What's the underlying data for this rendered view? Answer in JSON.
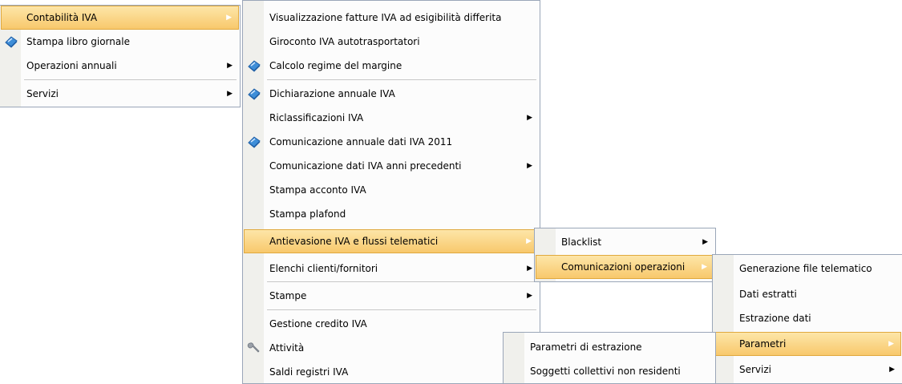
{
  "menu1": {
    "items": [
      {
        "label": "Contabilità IVA",
        "icon": "",
        "submenu": true,
        "highlighted": true
      },
      {
        "label": "Stampa libro giornale",
        "icon": "book-icon",
        "submenu": false
      },
      {
        "label": "Operazioni annuali",
        "icon": "",
        "submenu": true
      },
      {
        "label": "Servizi",
        "icon": "",
        "submenu": true
      }
    ]
  },
  "menu2": {
    "items": [
      {
        "label": "Visualizzazione fatture IVA ad esigibilità differita"
      },
      {
        "label": "Giroconto IVA autotrasportatori"
      },
      {
        "label": "Calcolo regime del margine",
        "icon": "book-icon"
      },
      {
        "label": "Dichiarazione annuale IVA",
        "icon": "book-icon"
      },
      {
        "label": "Riclassificazioni IVA",
        "submenu": true
      },
      {
        "label": "Comunicazione annuale dati IVA 2011",
        "icon": "book-icon"
      },
      {
        "label": "Comunicazione dati IVA anni precedenti",
        "submenu": true
      },
      {
        "label": "Stampa acconto IVA"
      },
      {
        "label": "Stampa plafond"
      },
      {
        "label": "Antievasione IVA e flussi telematici",
        "submenu": true,
        "highlighted": true
      },
      {
        "label": "Elenchi clienti/fornitori",
        "submenu": true
      },
      {
        "label": "Stampe",
        "submenu": true
      },
      {
        "label": "Gestione credito IVA"
      },
      {
        "label": "Attività",
        "icon": "wrench-icon"
      },
      {
        "label": "Saldi registri IVA"
      }
    ]
  },
  "menu3": {
    "items": [
      {
        "label": "Blacklist",
        "submenu": true
      },
      {
        "label": "Comunicazioni operazioni",
        "submenu": true,
        "highlighted": true
      }
    ]
  },
  "menu4": {
    "items": [
      {
        "label": "Generazione file telematico"
      },
      {
        "label": "Dati estratti"
      },
      {
        "label": "Estrazione dati"
      },
      {
        "label": "Parametri",
        "submenu": true,
        "highlighted": true
      },
      {
        "label": "Servizi",
        "submenu": true
      }
    ]
  },
  "menu5": {
    "items": [
      {
        "label": "Parametri di estrazione"
      },
      {
        "label": "Soggetti collettivi non residenti"
      }
    ]
  },
  "colors": {
    "highlight_top": "#fde6a8",
    "highlight_bottom": "#f8c86c",
    "border": "#9aa6b8",
    "gutter": "#f0f0ec"
  }
}
